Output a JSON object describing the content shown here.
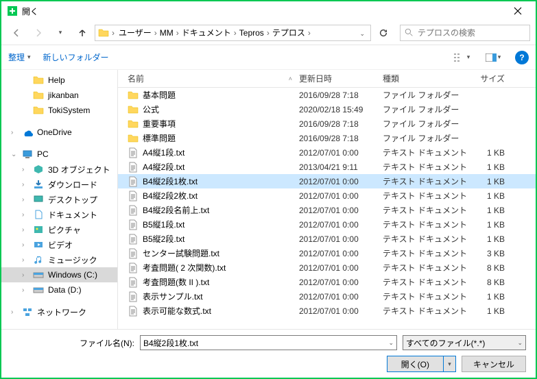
{
  "title": "開く",
  "breadcrumb": [
    "ユーザー",
    "MM",
    "ドキュメント",
    "Tepros",
    "テプロス"
  ],
  "search_placeholder": "テプロスの検索",
  "toolbar": {
    "organize": "整理",
    "newfolder": "新しいフォルダー"
  },
  "tree": [
    {
      "label": "Help",
      "icon": "folder",
      "level": 2
    },
    {
      "label": "jikanban",
      "icon": "folder",
      "level": 2
    },
    {
      "label": "TokiSystem",
      "icon": "folder",
      "level": 2
    },
    {
      "gap": true
    },
    {
      "label": "OneDrive",
      "icon": "onedrive",
      "level": 1,
      "exp": ">"
    },
    {
      "gap": true
    },
    {
      "label": "PC",
      "icon": "pc",
      "level": 1,
      "exp": "v"
    },
    {
      "label": "3D オブジェクト",
      "icon": "3d",
      "level": 2,
      "exp": ">"
    },
    {
      "label": "ダウンロード",
      "icon": "downloads",
      "level": 2,
      "exp": ">"
    },
    {
      "label": "デスクトップ",
      "icon": "desktop",
      "level": 2,
      "exp": ">"
    },
    {
      "label": "ドキュメント",
      "icon": "documents",
      "level": 2,
      "exp": ">"
    },
    {
      "label": "ピクチャ",
      "icon": "pictures",
      "level": 2,
      "exp": ">"
    },
    {
      "label": "ビデオ",
      "icon": "videos",
      "level": 2,
      "exp": ">"
    },
    {
      "label": "ミュージック",
      "icon": "music",
      "level": 2,
      "exp": ">"
    },
    {
      "label": "Windows (C:)",
      "icon": "drive",
      "level": 2,
      "exp": ">",
      "selected": true
    },
    {
      "label": "Data (D:)",
      "icon": "drive",
      "level": 2,
      "exp": ">"
    },
    {
      "gap": true
    },
    {
      "label": "ネットワーク",
      "icon": "network",
      "level": 1,
      "exp": ">"
    }
  ],
  "columns": {
    "name": "名前",
    "date": "更新日時",
    "type": "種類",
    "size": "サイズ"
  },
  "files": [
    {
      "name": "基本問題",
      "date": "2016/09/28 7:18",
      "type": "ファイル フォルダー",
      "size": "",
      "icon": "folder"
    },
    {
      "name": "公式",
      "date": "2020/02/18 15:49",
      "type": "ファイル フォルダー",
      "size": "",
      "icon": "folder"
    },
    {
      "name": "重要事項",
      "date": "2016/09/28 7:18",
      "type": "ファイル フォルダー",
      "size": "",
      "icon": "folder"
    },
    {
      "name": "標準問題",
      "date": "2016/09/28 7:18",
      "type": "ファイル フォルダー",
      "size": "",
      "icon": "folder"
    },
    {
      "name": "A4縦1段.txt",
      "date": "2012/07/01 0:00",
      "type": "テキスト ドキュメント",
      "size": "1 KB",
      "icon": "txt"
    },
    {
      "name": "A4縦2段.txt",
      "date": "2013/04/21 9:11",
      "type": "テキスト ドキュメント",
      "size": "1 KB",
      "icon": "txt"
    },
    {
      "name": "B4縦2段1枚.txt",
      "date": "2012/07/01 0:00",
      "type": "テキスト ドキュメント",
      "size": "1 KB",
      "icon": "txt",
      "selected": true
    },
    {
      "name": "B4縦2段2枚.txt",
      "date": "2012/07/01 0:00",
      "type": "テキスト ドキュメント",
      "size": "1 KB",
      "icon": "txt"
    },
    {
      "name": "B4縦2段名前上.txt",
      "date": "2012/07/01 0:00",
      "type": "テキスト ドキュメント",
      "size": "1 KB",
      "icon": "txt"
    },
    {
      "name": "B5縦1段.txt",
      "date": "2012/07/01 0:00",
      "type": "テキスト ドキュメント",
      "size": "1 KB",
      "icon": "txt"
    },
    {
      "name": "B5縦2段.txt",
      "date": "2012/07/01 0:00",
      "type": "テキスト ドキュメント",
      "size": "1 KB",
      "icon": "txt"
    },
    {
      "name": "センター試験問題.txt",
      "date": "2012/07/01 0:00",
      "type": "テキスト ドキュメント",
      "size": "3 KB",
      "icon": "txt"
    },
    {
      "name": "考査問題( 2 次関数).txt",
      "date": "2012/07/01 0:00",
      "type": "テキスト ドキュメント",
      "size": "8 KB",
      "icon": "txt"
    },
    {
      "name": "考査問題(数 II ).txt",
      "date": "2012/07/01 0:00",
      "type": "テキスト ドキュメント",
      "size": "8 KB",
      "icon": "txt"
    },
    {
      "name": "表示サンプル.txt",
      "date": "2012/07/01 0:00",
      "type": "テキスト ドキュメント",
      "size": "1 KB",
      "icon": "txt"
    },
    {
      "name": "表示可能な数式.txt",
      "date": "2012/07/01 0:00",
      "type": "テキスト ドキュメント",
      "size": "1 KB",
      "icon": "txt"
    }
  ],
  "footer": {
    "filename_label": "ファイル名(N):",
    "filename_value": "B4縦2段1枚.txt",
    "filter": "すべてのファイル(*.*)",
    "open": "開く(O)",
    "cancel": "キャンセル"
  }
}
